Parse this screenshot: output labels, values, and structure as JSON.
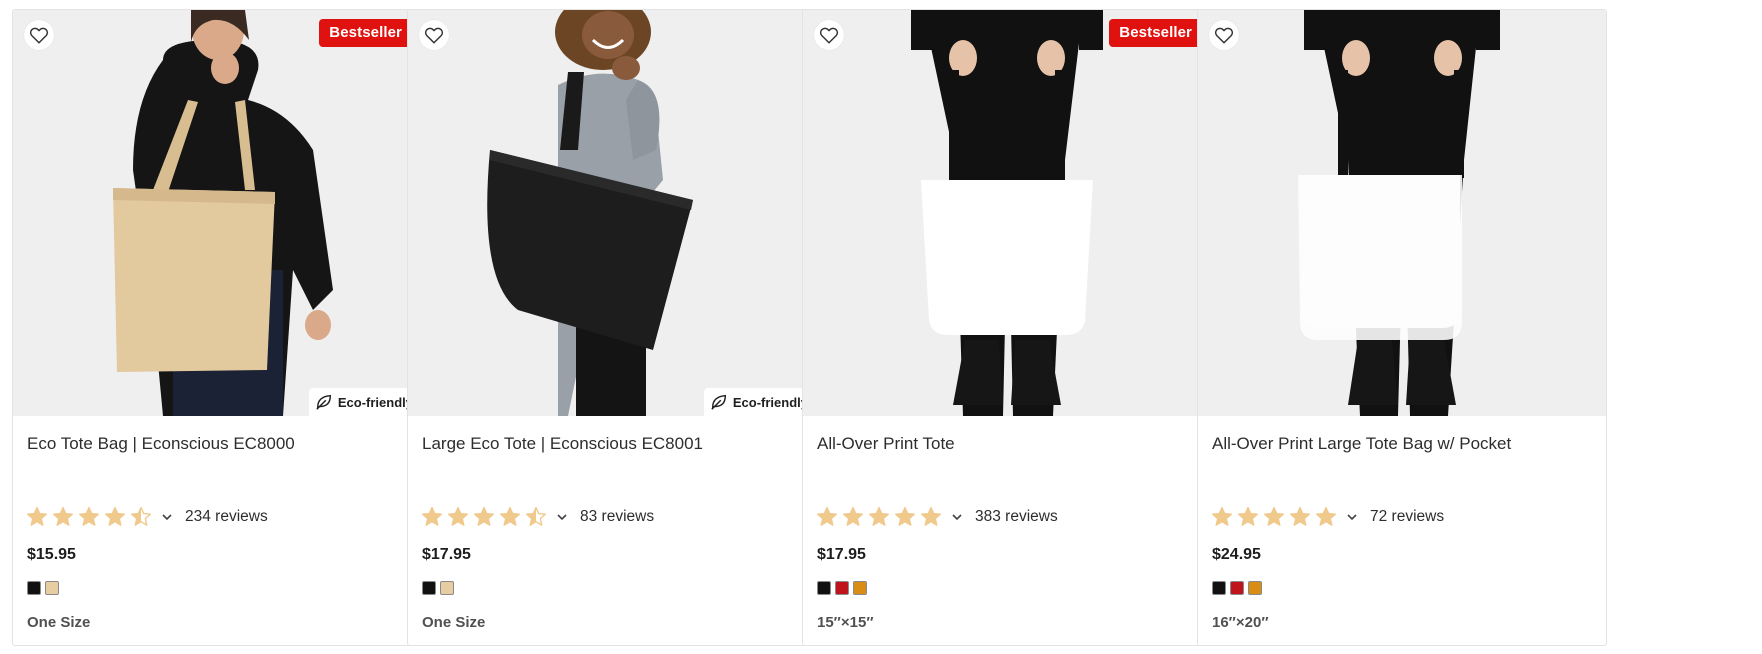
{
  "products": [
    {
      "title": "Eco Tote Bag | Econscious EC8000",
      "badge": "Bestseller",
      "eco_label": "Eco-friendly",
      "rating": 4.5,
      "reviews": "234 reviews",
      "price": "$15.95",
      "colors": [
        "#111111",
        "#e9cda2"
      ],
      "size": "One Size",
      "image": "model-with-beige-tote"
    },
    {
      "title": "Large Eco Tote | Econscious EC8001",
      "badge": "",
      "eco_label": "Eco-friendly",
      "rating": 4.5,
      "reviews": "83 reviews",
      "price": "$17.95",
      "colors": [
        "#111111",
        "#e9cda2"
      ],
      "size": "One Size",
      "image": "model-with-black-tote"
    },
    {
      "title": "All-Over Print Tote",
      "badge": "Bestseller",
      "eco_label": "",
      "rating": 5,
      "reviews": "383 reviews",
      "price": "$17.95",
      "colors": [
        "#111111",
        "#c0141c",
        "#d98d14"
      ],
      "size": "15″×15″",
      "image": "model-holding-white-tote"
    },
    {
      "title": "All-Over Print Large Tote Bag w/ Pocket",
      "badge": "",
      "eco_label": "",
      "rating": 5,
      "reviews": "72 reviews",
      "price": "$24.95",
      "colors": [
        "#111111",
        "#c0141c",
        "#d98d14"
      ],
      "size": "16″×20″",
      "image": "model-holding-large-white-tote"
    }
  ],
  "star_color": "#f0c98c",
  "badge_color": "#e0120f",
  "icons": {
    "favorite": "heart-outline-icon",
    "eco": "leaf-icon",
    "expand": "chevron-down-icon"
  }
}
